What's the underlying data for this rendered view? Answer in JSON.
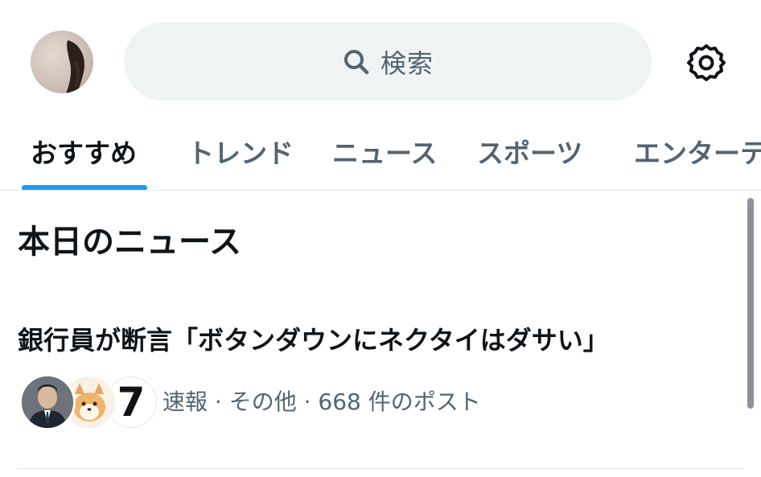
{
  "header": {
    "search_placeholder": "検索",
    "icons": {
      "search": "search-icon",
      "settings": "gear-icon"
    }
  },
  "tabs": [
    {
      "label": "おすすめ",
      "active": true
    },
    {
      "label": "トレンド",
      "active": false
    },
    {
      "label": "ニュース",
      "active": false
    },
    {
      "label": "スポーツ",
      "active": false
    },
    {
      "label": "エンターテ",
      "active": false
    }
  ],
  "section": {
    "title": "本日のニュース"
  },
  "news_item": {
    "title": "銀行員が断言「ボタンダウンにネクタイはダサい」",
    "avatar_badge": "7",
    "meta": "速報 · その他 · 668 件のポスト"
  },
  "colors": {
    "accent": "#1d9bf0",
    "text_primary": "#0f1419",
    "text_secondary": "#536471",
    "search_bg": "#eff3f4"
  }
}
